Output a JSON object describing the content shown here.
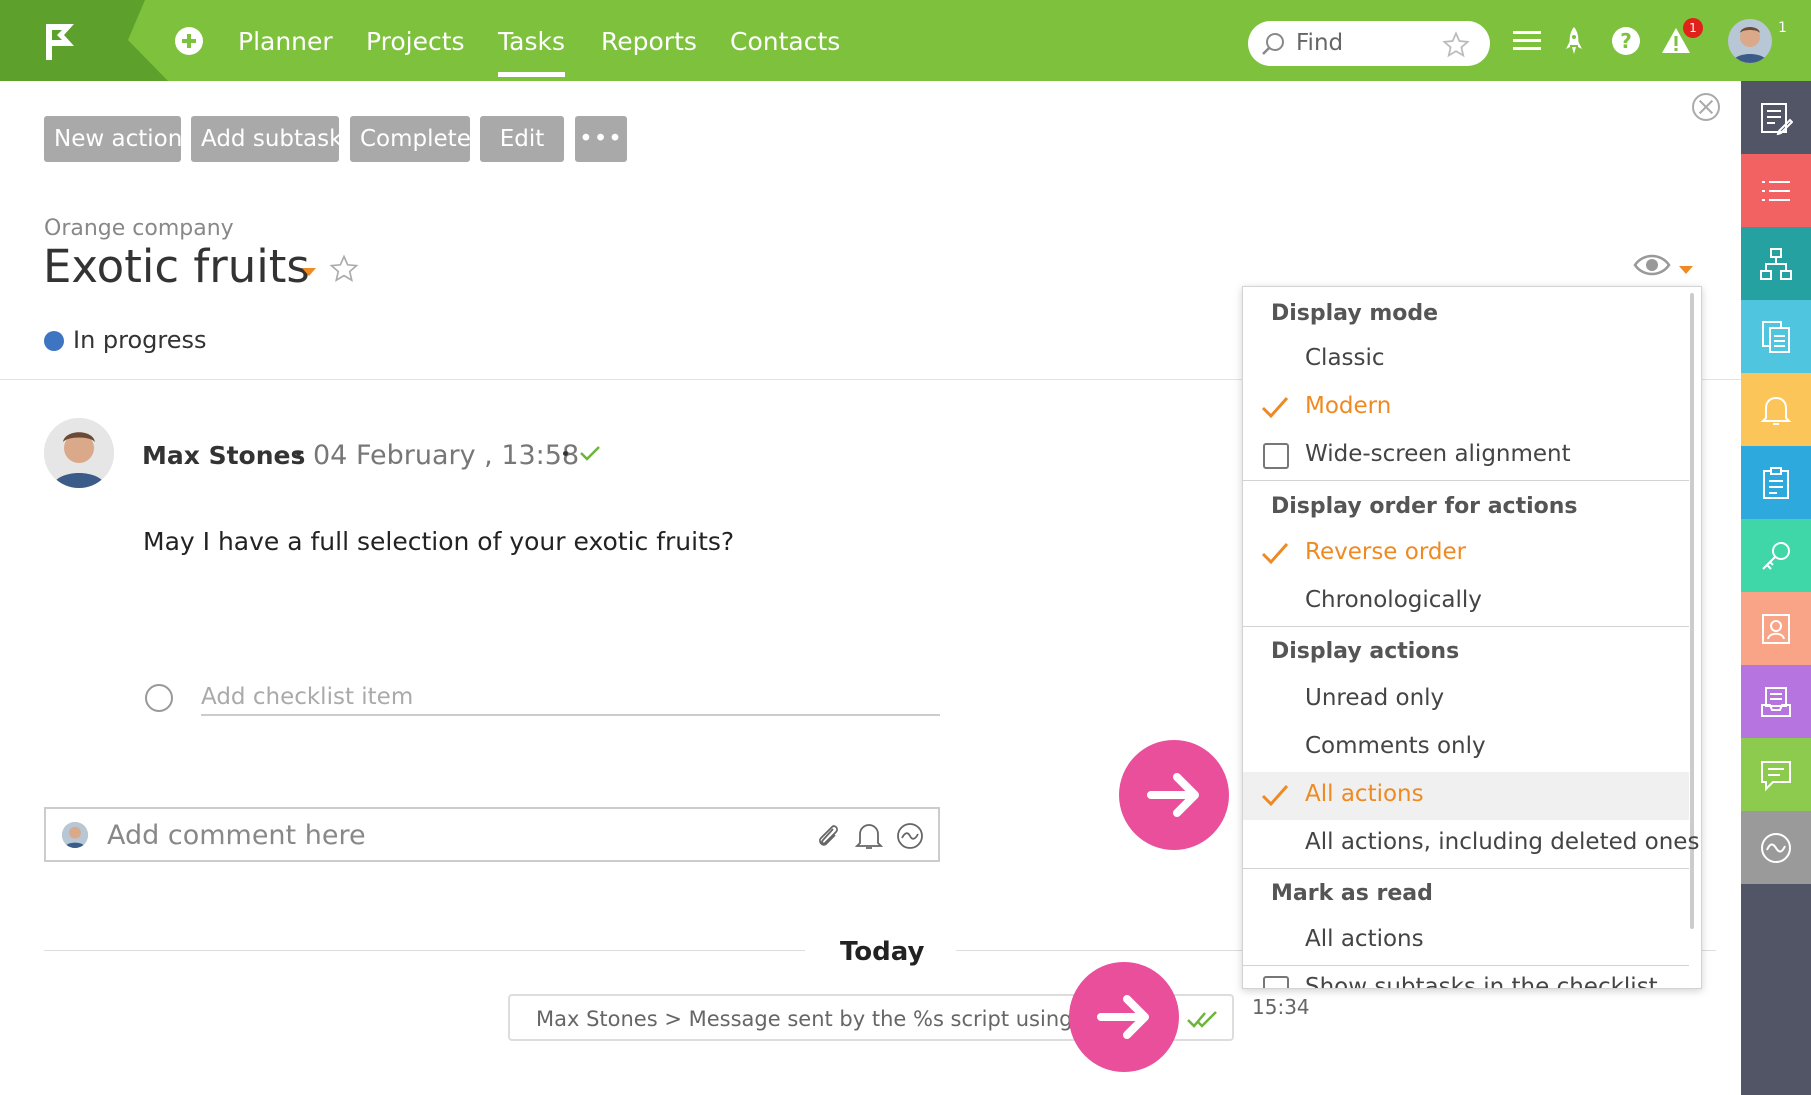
{
  "topbar": {
    "nav": [
      "Planner",
      "Projects",
      "Tasks",
      "Reports",
      "Contacts"
    ],
    "active_nav": "Tasks",
    "search_placeholder": "Find",
    "notification_count": "1",
    "avatar_count": "1"
  },
  "toolbar": {
    "new_action": "New action",
    "add_subtask": "Add subtask",
    "complete": "Complete",
    "edit": "Edit",
    "more": "•••"
  },
  "task": {
    "company": "Orange company",
    "title": "Exotic fruits",
    "status": "In progress"
  },
  "post": {
    "author": "Max Stones",
    "date": "04 February , 13:58",
    "text": "May I have a full selection of your exotic fruits?",
    "checklist_placeholder": "Add checklist item"
  },
  "comment": {
    "placeholder": "Add comment here"
  },
  "timeline": {
    "today": "Today",
    "message": "Max Stones >  Message sent by the %s script using the %s",
    "time": "15:34"
  },
  "dropdown": {
    "display_mode": "Display mode",
    "classic": "Classic",
    "modern": "Modern",
    "wide_screen": "Wide-screen alignment",
    "display_order": "Display order for actions",
    "reverse_order": "Reverse order",
    "chronologically": "Chronologically",
    "display_actions": "Display actions",
    "unread_only": "Unread only",
    "comments_only": "Comments only",
    "all_actions": "All actions",
    "all_including_deleted": "All actions, including deleted ones",
    "mark_as_read": "Mark as read",
    "mark_all_actions": "All actions",
    "show_subtasks": "Show subtasks in the checklist"
  },
  "colors": {
    "topbar": "#7dc13c",
    "accent": "#ef8a22",
    "highlight_arrow": "#e94f9b",
    "rightbar": "#525566"
  },
  "rightbar_icons": [
    "edit-list-icon",
    "list-icon",
    "hierarchy-icon",
    "documents-icon",
    "bell-icon",
    "clipboard-icon",
    "key-icon",
    "contact-card-icon",
    "inbox-icon",
    "chat-icon",
    "wave-icon"
  ]
}
